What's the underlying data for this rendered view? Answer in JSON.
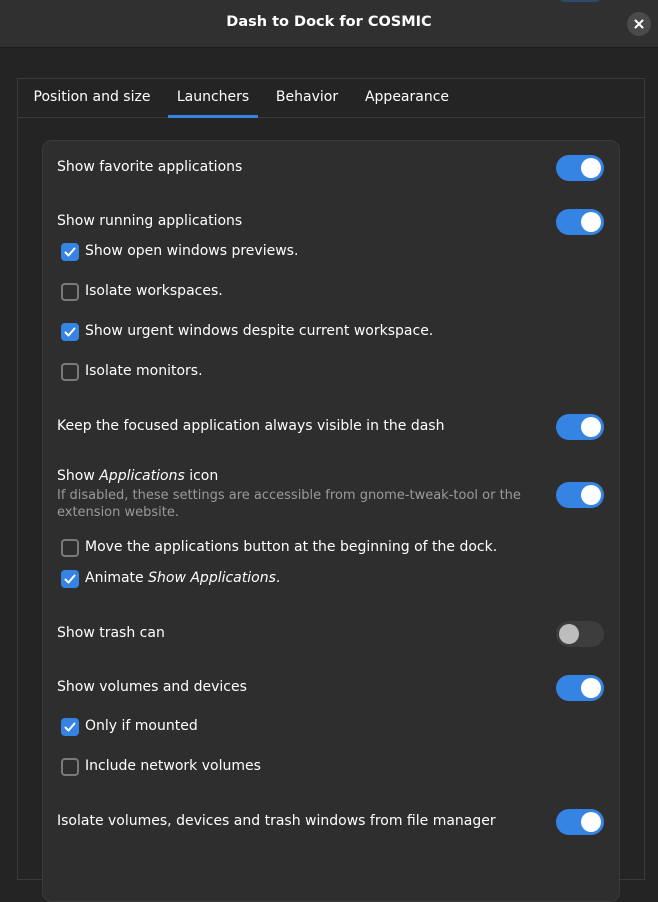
{
  "window": {
    "title": "Dash to Dock for COSMIC"
  },
  "tabs": [
    {
      "label": "Position and size",
      "active": false
    },
    {
      "label": "Launchers",
      "active": true
    },
    {
      "label": "Behavior",
      "active": false
    },
    {
      "label": "Appearance",
      "active": false
    }
  ],
  "settings": {
    "show_favorites": {
      "label": "Show favorite applications",
      "enabled": true
    },
    "show_running": {
      "label": "Show running applications",
      "enabled": true
    },
    "open_windows_previews": {
      "label": "Show open windows previews.",
      "checked": true
    },
    "isolate_workspaces": {
      "label": "Isolate workspaces.",
      "checked": false
    },
    "urgent_windows": {
      "label": "Show urgent windows despite current workspace.",
      "checked": true
    },
    "isolate_monitors": {
      "label": "Isolate monitors.",
      "checked": false
    },
    "keep_focused": {
      "label": "Keep the focused application always visible in the dash",
      "enabled": true
    },
    "show_apps_icon": {
      "label_prefix": "Show",
      "label_italic": "Applications",
      "label_suffix": "icon",
      "description": "If disabled, these settings are accessible from gnome-tweak-tool or the extension website.",
      "enabled": true
    },
    "apps_button_beginning": {
      "label": "Move the applications button at the beginning of the dock.",
      "checked": false
    },
    "animate_show_apps": {
      "label_prefix": "Animate",
      "label_italic": "Show Applications",
      "label_suffix": ".",
      "checked": true
    },
    "show_trash": {
      "label": "Show trash can",
      "enabled": false
    },
    "show_volumes": {
      "label": "Show volumes and devices",
      "enabled": true
    },
    "only_if_mounted": {
      "label": "Only if mounted",
      "checked": true
    },
    "network_volumes": {
      "label": "Include network volumes",
      "checked": false
    },
    "isolate_volumes": {
      "label": "Isolate volumes, devices and trash windows from file manager",
      "enabled": true
    }
  },
  "colors": {
    "accent": "#3584e4",
    "window_bg": "#242424",
    "panel_bg": "#2e2e2e",
    "titlebar_bg": "#303030"
  }
}
